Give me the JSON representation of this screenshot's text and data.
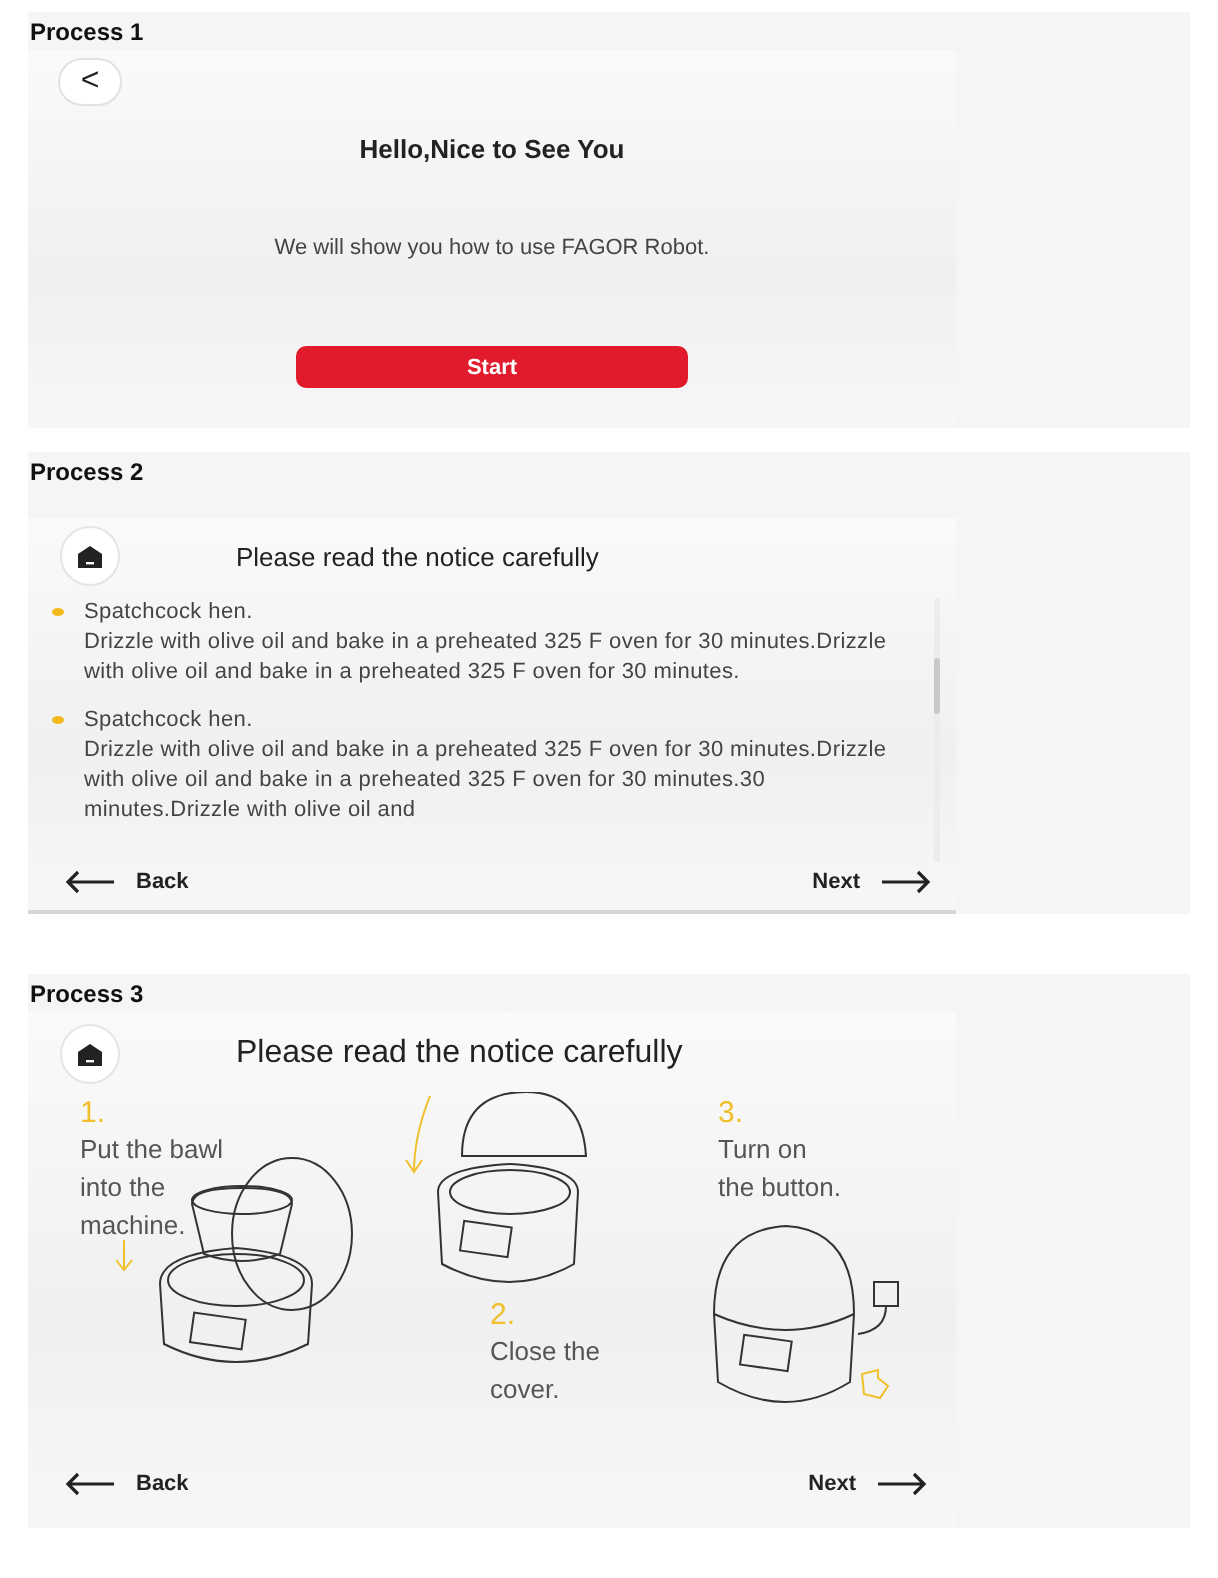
{
  "sections": [
    {
      "label": "Process 1",
      "kind": "welcome",
      "back": "<",
      "title": "Hello,Nice to See You",
      "message": "We will show you how to use FAGOR Robot.",
      "button": "Start"
    },
    {
      "label": "Process 2",
      "kind": "notice",
      "title": "Please read the notice carefully",
      "items": [
        {
          "heading": "Spatchcock hen.",
          "body": "Drizzle with olive oil and bake in a preheated 325 F oven for 30 minutes.Drizzle with olive oil and bake in a preheated 325 F oven for 30 minutes."
        },
        {
          "heading": "Spatchcock hen.",
          "body": "Drizzle with olive oil and bake in a preheated 325 F oven for 30 minutes.Drizzle with olive oil and bake in a preheated 325 F oven for 30 minutes.30 minutes.Drizzle with olive oil and"
        }
      ],
      "back": "Back",
      "next": "Next"
    },
    {
      "label": "Process 3",
      "kind": "steps",
      "title": "Please read the notice carefully",
      "steps": [
        {
          "number": "1.",
          "text": "Put the bawl\ninto the\nmachine."
        },
        {
          "number": "2.",
          "text": "Close the\ncover."
        },
        {
          "number": "3.",
          "text": "Turn on\nthe button."
        }
      ],
      "back": "Back",
      "next": "Next"
    }
  ]
}
